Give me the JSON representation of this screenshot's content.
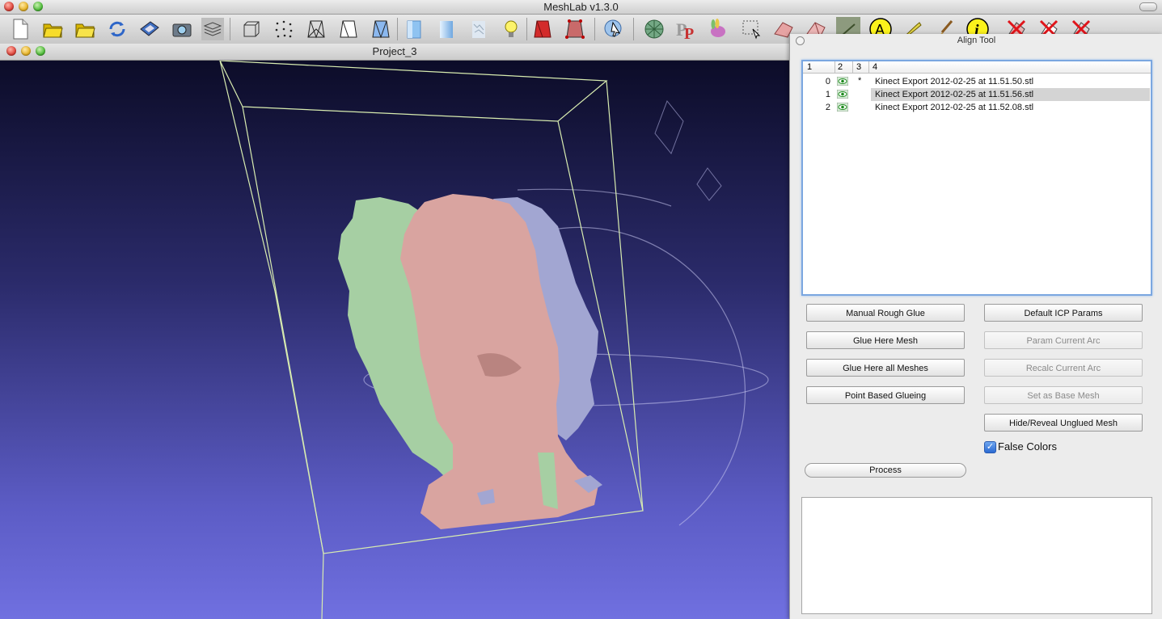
{
  "app": {
    "title": "MeshLab v1.3.0"
  },
  "document": {
    "title": "Project_3"
  },
  "toolbar": {
    "icons": [
      "new-document-icon",
      "open-layers-icon",
      "open-folder-icon",
      "reload-icon",
      "save-icon",
      "snapshot-icon",
      "layers-icon",
      "bbox-icon",
      "points-icon",
      "wireframe-icon",
      "hidden-lines-icon",
      "flat-lines-icon",
      "flat-shading-icon",
      "smooth-shading-icon",
      "texture-icon",
      "light-bulb-icon",
      "color-mesh-icon",
      "vertex-select-icon",
      "info-pick-icon",
      "globe-icon",
      "pp-icon",
      "bunny-icon",
      "select-region-icon",
      "select-faces-icon",
      "select-vertices-icon",
      "align-icon",
      "annotation-icon",
      "paint-icon",
      "brush-icon",
      "info-icon",
      "delete-faces-icon",
      "delete-vertices-icon",
      "delete-all-icon"
    ]
  },
  "align_tool": {
    "title": "Align Tool",
    "columns": [
      "1",
      "2",
      "3",
      "4"
    ],
    "rows": [
      {
        "index": "0",
        "base": "*",
        "name": "Kinect Export 2012-02-25 at 11.51.50.stl",
        "selected": false
      },
      {
        "index": "1",
        "base": "",
        "name": "Kinect Export 2012-02-25 at 11.51.56.stl",
        "selected": true
      },
      {
        "index": "2",
        "base": "",
        "name": "Kinect Export 2012-02-25 at 11.52.08.stl",
        "selected": false
      }
    ],
    "buttons": {
      "manual_rough_glue": "Manual Rough Glue",
      "default_icp_params": "Default ICP Params",
      "glue_here_mesh": "Glue Here Mesh",
      "param_current_arc": "Param Current Arc",
      "glue_here_all": "Glue Here all Meshes",
      "recalc_current_arc": "Recalc Current Arc",
      "point_based_glueing": "Point Based Glueing",
      "set_as_base_mesh": "Set as Base Mesh",
      "hide_reveal": "Hide/Reveal Unglued Mesh",
      "process": "Process"
    },
    "false_colors": {
      "label": "False Colors",
      "checked": true
    }
  },
  "colors": {
    "mesh_green": "#a6cfa3",
    "mesh_pink": "#d9a4a0",
    "mesh_blue": "#a2a6d2",
    "selection": "#d4d4d4"
  }
}
